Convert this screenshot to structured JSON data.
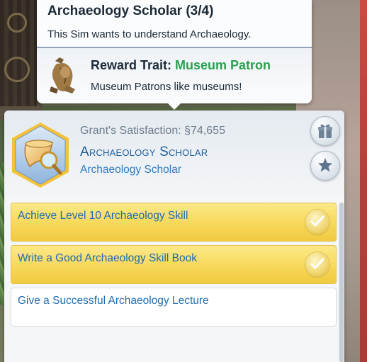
{
  "tooltip": {
    "title": "Archaeology Scholar (3/4)",
    "description": "This Sim wants to understand Archaeology.",
    "reward_label": "Reward Trait: ",
    "reward_trait": "Museum Patron",
    "reward_description": "Museum Patrons like museums!",
    "reward_icon": "museum-patron-statue-icon"
  },
  "aspiration": {
    "satisfaction_label": "Grant's Satisfaction: ",
    "satisfaction_value": "74,655",
    "currency_symbol": "§",
    "name": "Archaeology Scholar",
    "subtitle": "Archaeology Scholar",
    "icon": "horn-magnifier-icon"
  },
  "buttons": {
    "gift_icon": "gift-icon",
    "star_icon": "star-burst-icon"
  },
  "goals": [
    {
      "label": "Achieve Level 10 Archaeology Skill",
      "completed": true
    },
    {
      "label": "Write a Good Archaeology Skill Book",
      "completed": true
    },
    {
      "label": "Give a Successful Archaeology Lecture",
      "completed": false
    }
  ],
  "colors": {
    "trait_green": "#2aa150",
    "title_blue": "#1f5f9f",
    "goal_text_blue": "#1f6bb0",
    "completed_goal_yellow": "#f7d85a"
  }
}
